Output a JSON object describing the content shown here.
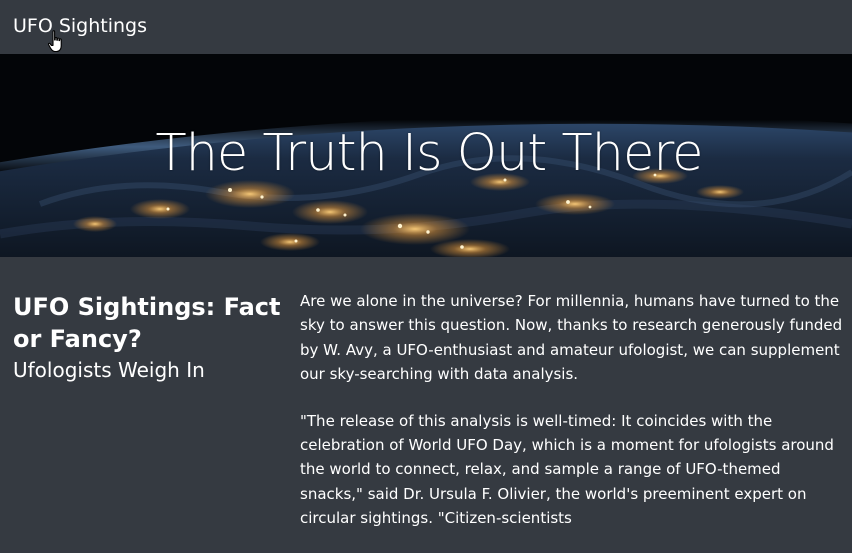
{
  "navbar": {
    "brand": "UFO Sightings"
  },
  "hero": {
    "title": "The Truth Is Out There"
  },
  "article": {
    "heading": "UFO Sightings: Fact or Fancy?",
    "subheading": "Ufologists Weigh In",
    "paragraphs": [
      "Are we alone in the universe? For millennia, humans have turned to the sky to answer this question. Now, thanks to research generously funded by W. Avy, a UFO-enthusiast and amateur ufologist, we can supplement our sky-searching with data analysis.",
      "\"The release of this analysis is well-timed: It coincides with the celebration of World UFO Day, which is a moment for ufologists around the world to connect, relax, and sample a range of UFO-themed snacks,\" said Dr. Ursula F. Olivier, the world's preeminent expert on circular sightings. \"Citizen-scientists"
    ]
  },
  "colors": {
    "background": "#353a41",
    "text": "#ffffff",
    "hero_sky": "#04070c",
    "city_lights": "#ffc36b"
  },
  "icons": {
    "cursor": "hand-pointer-icon"
  }
}
